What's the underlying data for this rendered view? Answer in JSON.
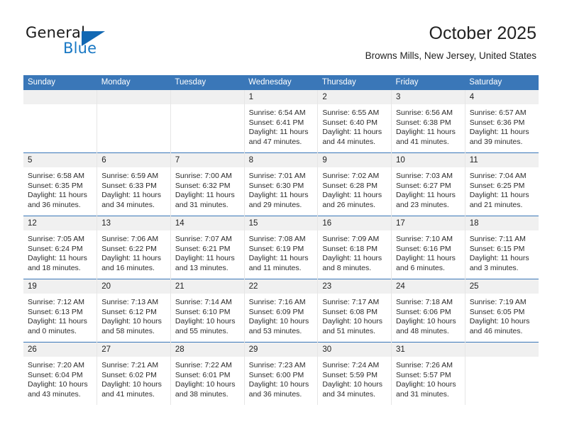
{
  "brand": {
    "name_part1": "General",
    "name_part2": "Blue",
    "triangle_icon": "triangle-icon",
    "accent_color": "#1268b3"
  },
  "header": {
    "month_title": "October 2025",
    "location": "Browns Mills, New Jersey, United States"
  },
  "calendar": {
    "header_bg": "#3a77b8",
    "daynum_bg": "#f0f0f0",
    "weekdays": [
      "Sunday",
      "Monday",
      "Tuesday",
      "Wednesday",
      "Thursday",
      "Friday",
      "Saturday"
    ],
    "weeks": [
      [
        {
          "day": "",
          "lines": []
        },
        {
          "day": "",
          "lines": []
        },
        {
          "day": "",
          "lines": []
        },
        {
          "day": "1",
          "lines": [
            "Sunrise: 6:54 AM",
            "Sunset: 6:41 PM",
            "Daylight: 11 hours",
            "and 47 minutes."
          ]
        },
        {
          "day": "2",
          "lines": [
            "Sunrise: 6:55 AM",
            "Sunset: 6:40 PM",
            "Daylight: 11 hours",
            "and 44 minutes."
          ]
        },
        {
          "day": "3",
          "lines": [
            "Sunrise: 6:56 AM",
            "Sunset: 6:38 PM",
            "Daylight: 11 hours",
            "and 41 minutes."
          ]
        },
        {
          "day": "4",
          "lines": [
            "Sunrise: 6:57 AM",
            "Sunset: 6:36 PM",
            "Daylight: 11 hours",
            "and 39 minutes."
          ]
        }
      ],
      [
        {
          "day": "5",
          "lines": [
            "Sunrise: 6:58 AM",
            "Sunset: 6:35 PM",
            "Daylight: 11 hours",
            "and 36 minutes."
          ]
        },
        {
          "day": "6",
          "lines": [
            "Sunrise: 6:59 AM",
            "Sunset: 6:33 PM",
            "Daylight: 11 hours",
            "and 34 minutes."
          ]
        },
        {
          "day": "7",
          "lines": [
            "Sunrise: 7:00 AM",
            "Sunset: 6:32 PM",
            "Daylight: 11 hours",
            "and 31 minutes."
          ]
        },
        {
          "day": "8",
          "lines": [
            "Sunrise: 7:01 AM",
            "Sunset: 6:30 PM",
            "Daylight: 11 hours",
            "and 29 minutes."
          ]
        },
        {
          "day": "9",
          "lines": [
            "Sunrise: 7:02 AM",
            "Sunset: 6:28 PM",
            "Daylight: 11 hours",
            "and 26 minutes."
          ]
        },
        {
          "day": "10",
          "lines": [
            "Sunrise: 7:03 AM",
            "Sunset: 6:27 PM",
            "Daylight: 11 hours",
            "and 23 minutes."
          ]
        },
        {
          "day": "11",
          "lines": [
            "Sunrise: 7:04 AM",
            "Sunset: 6:25 PM",
            "Daylight: 11 hours",
            "and 21 minutes."
          ]
        }
      ],
      [
        {
          "day": "12",
          "lines": [
            "Sunrise: 7:05 AM",
            "Sunset: 6:24 PM",
            "Daylight: 11 hours",
            "and 18 minutes."
          ]
        },
        {
          "day": "13",
          "lines": [
            "Sunrise: 7:06 AM",
            "Sunset: 6:22 PM",
            "Daylight: 11 hours",
            "and 16 minutes."
          ]
        },
        {
          "day": "14",
          "lines": [
            "Sunrise: 7:07 AM",
            "Sunset: 6:21 PM",
            "Daylight: 11 hours",
            "and 13 minutes."
          ]
        },
        {
          "day": "15",
          "lines": [
            "Sunrise: 7:08 AM",
            "Sunset: 6:19 PM",
            "Daylight: 11 hours",
            "and 11 minutes."
          ]
        },
        {
          "day": "16",
          "lines": [
            "Sunrise: 7:09 AM",
            "Sunset: 6:18 PM",
            "Daylight: 11 hours",
            "and 8 minutes."
          ]
        },
        {
          "day": "17",
          "lines": [
            "Sunrise: 7:10 AM",
            "Sunset: 6:16 PM",
            "Daylight: 11 hours",
            "and 6 minutes."
          ]
        },
        {
          "day": "18",
          "lines": [
            "Sunrise: 7:11 AM",
            "Sunset: 6:15 PM",
            "Daylight: 11 hours",
            "and 3 minutes."
          ]
        }
      ],
      [
        {
          "day": "19",
          "lines": [
            "Sunrise: 7:12 AM",
            "Sunset: 6:13 PM",
            "Daylight: 11 hours",
            "and 0 minutes."
          ]
        },
        {
          "day": "20",
          "lines": [
            "Sunrise: 7:13 AM",
            "Sunset: 6:12 PM",
            "Daylight: 10 hours",
            "and 58 minutes."
          ]
        },
        {
          "day": "21",
          "lines": [
            "Sunrise: 7:14 AM",
            "Sunset: 6:10 PM",
            "Daylight: 10 hours",
            "and 55 minutes."
          ]
        },
        {
          "day": "22",
          "lines": [
            "Sunrise: 7:16 AM",
            "Sunset: 6:09 PM",
            "Daylight: 10 hours",
            "and 53 minutes."
          ]
        },
        {
          "day": "23",
          "lines": [
            "Sunrise: 7:17 AM",
            "Sunset: 6:08 PM",
            "Daylight: 10 hours",
            "and 51 minutes."
          ]
        },
        {
          "day": "24",
          "lines": [
            "Sunrise: 7:18 AM",
            "Sunset: 6:06 PM",
            "Daylight: 10 hours",
            "and 48 minutes."
          ]
        },
        {
          "day": "25",
          "lines": [
            "Sunrise: 7:19 AM",
            "Sunset: 6:05 PM",
            "Daylight: 10 hours",
            "and 46 minutes."
          ]
        }
      ],
      [
        {
          "day": "26",
          "lines": [
            "Sunrise: 7:20 AM",
            "Sunset: 6:04 PM",
            "Daylight: 10 hours",
            "and 43 minutes."
          ]
        },
        {
          "day": "27",
          "lines": [
            "Sunrise: 7:21 AM",
            "Sunset: 6:02 PM",
            "Daylight: 10 hours",
            "and 41 minutes."
          ]
        },
        {
          "day": "28",
          "lines": [
            "Sunrise: 7:22 AM",
            "Sunset: 6:01 PM",
            "Daylight: 10 hours",
            "and 38 minutes."
          ]
        },
        {
          "day": "29",
          "lines": [
            "Sunrise: 7:23 AM",
            "Sunset: 6:00 PM",
            "Daylight: 10 hours",
            "and 36 minutes."
          ]
        },
        {
          "day": "30",
          "lines": [
            "Sunrise: 7:24 AM",
            "Sunset: 5:59 PM",
            "Daylight: 10 hours",
            "and 34 minutes."
          ]
        },
        {
          "day": "31",
          "lines": [
            "Sunrise: 7:26 AM",
            "Sunset: 5:57 PM",
            "Daylight: 10 hours",
            "and 31 minutes."
          ]
        },
        {
          "day": "",
          "lines": []
        }
      ]
    ]
  }
}
